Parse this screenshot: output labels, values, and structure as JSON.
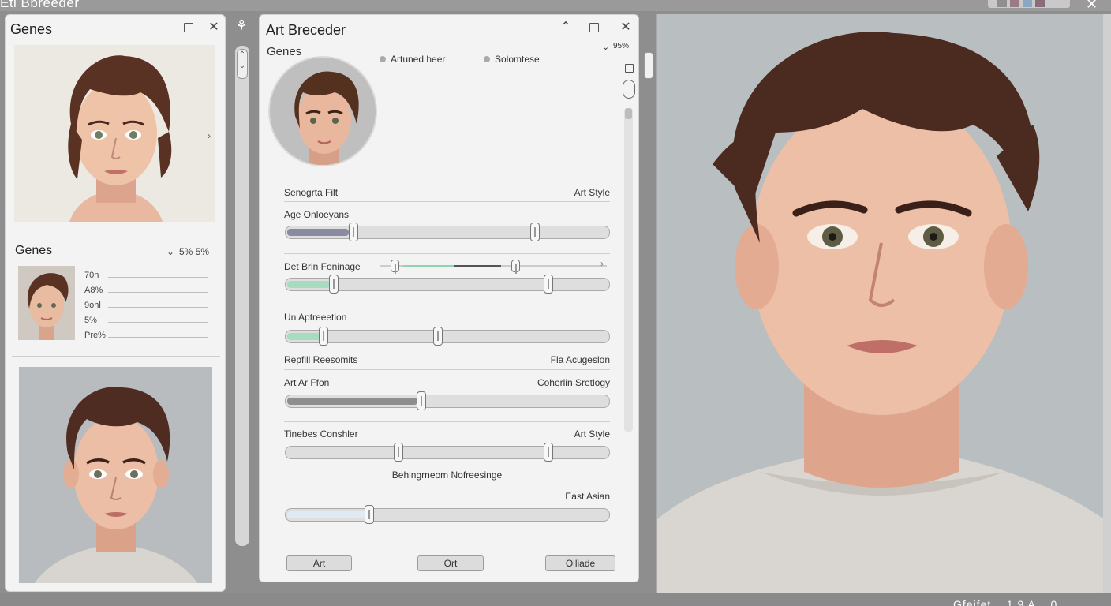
{
  "app": {
    "title": "Eti Bbreeder"
  },
  "left_panel": {
    "title": "Genes",
    "section_title": "Genes",
    "section_value": "5% 5%",
    "rows": [
      "70n",
      "A8%",
      "9ohl",
      "5%",
      "Pre%"
    ]
  },
  "center_panel": {
    "title": "Art Breceder",
    "genes_label": "Genes",
    "zoom_value": "95%",
    "radio_1": "Artuned heer",
    "radio_2": "Solomtese",
    "header_left": "Senogrta Filt",
    "header_right": "Art Style",
    "sliders": [
      {
        "label": "Age Onloeyans",
        "right_label": "",
        "fill": 0.2,
        "fill_color": "#8a8aa0",
        "thumbs": [
          0.21,
          0.77
        ]
      },
      {
        "label": "Det Brin Foninage",
        "right_label": "",
        "fill": 0.14,
        "fill_color": "#a8dcc0",
        "thumbs": [
          0.15,
          0.81
        ]
      },
      {
        "label": "Un Aptreeetion",
        "right_label": "",
        "fill": 0.12,
        "fill_color": "#a8dcc0",
        "thumbs": [
          0.12,
          0.47
        ]
      },
      {
        "label": "Art Ar Ffon",
        "right_label": "Coherlin Sretlogy",
        "fill": 0.41,
        "fill_color": "#8e8e8e",
        "thumbs": [
          0.42
        ]
      },
      {
        "label": "Tinebes Conshler",
        "right_label": "Art Style",
        "fill": 0.0,
        "fill_color": "#cfcfcf",
        "thumbs": [
          0.35,
          0.81
        ]
      },
      {
        "label": "",
        "right_label": "East Asian",
        "fill": 0.26,
        "fill_color": "#dfeaf2",
        "thumbs": [
          0.26
        ]
      }
    ],
    "mini_slider_thumbs": [
      0.05,
      0.58
    ],
    "section_row": {
      "left": "Repfill Reesomits",
      "right": "Fla Acugeslon"
    },
    "caption": "Behingrneom Nofreesinge",
    "buttons": [
      "Art",
      "Ort",
      "Olliade"
    ]
  },
  "bottom_status": "Gfeifet .. 1 9 A .. 0 .."
}
